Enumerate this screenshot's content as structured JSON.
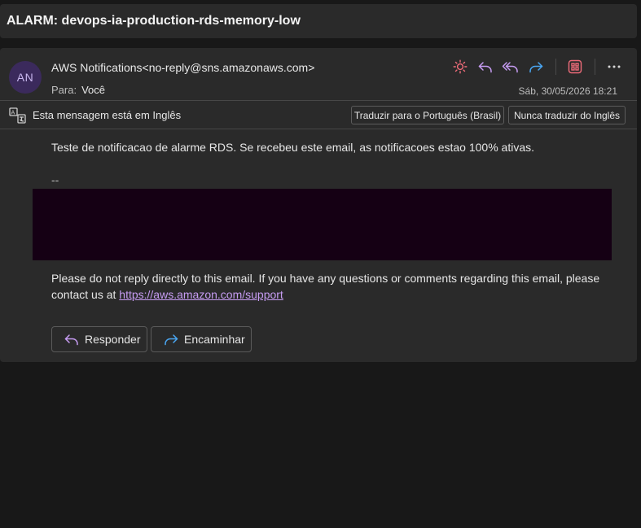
{
  "subject": "ALARM: devops-ia-production-rds-memory-low",
  "header": {
    "avatar_initials": "AN",
    "sender": "AWS Notifications<no-reply@sns.amazonaws.com>",
    "to_label": "Para:",
    "to_value": "Você",
    "date": "Sáb, 30/05/2026 18:21",
    "action_icons": [
      "sun-icon",
      "reply-icon",
      "reply-all-icon",
      "forward-icon",
      "apps-icon",
      "more-icon"
    ]
  },
  "translate": {
    "message": "Esta mensagem está em Inglês",
    "translate_button": "Traduzir para o Português (Brasil)",
    "never_button": "Nunca traduzir do Inglês"
  },
  "body": {
    "text": "Teste de notificacao de alarme RDS. Se recebeu este email, as notificacoes estao 100% ativas.",
    "signature_dash": "--",
    "footer_text": "Please do not reply directly to this email. If you have any questions or comments regarding this email, please contact us at",
    "footer_link": "https://aws.amazon.com/support"
  },
  "reply_actions": {
    "reply": "Responder",
    "forward": "Encaminhar"
  },
  "colors": {
    "background": "#181818",
    "card": "#2a2a2a",
    "accent_purple": "#c69cf2",
    "accent_blue": "#4aa6f2",
    "accent_red": "#f06c7a",
    "redacted_block": "#150014"
  }
}
